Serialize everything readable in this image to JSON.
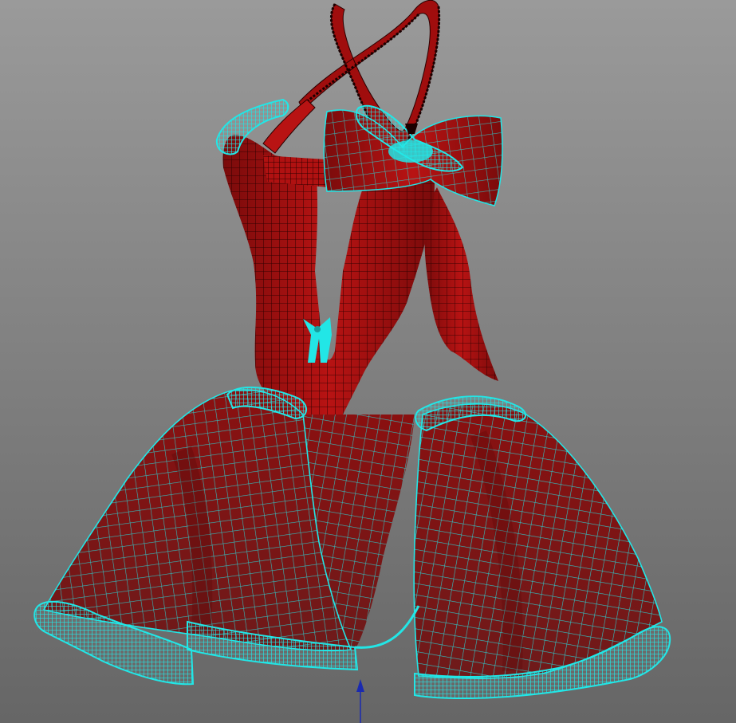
{
  "viewport": {
    "background_top": "#9a9a9a",
    "background_bottom": "#666666"
  },
  "model": {
    "object": "dress-mesh",
    "render_mode": "wireframe-on-shaded",
    "fill_color": "#8e0c0c",
    "fill_highlight": "#c01515",
    "wire_color_unselected": "#1a0000",
    "wire_color_selected": "#22e6e6",
    "parts": [
      {
        "id": "shoulder-straps",
        "selected": false
      },
      {
        "id": "bodice",
        "selected": false
      },
      {
        "id": "back-bow",
        "selected": false
      },
      {
        "id": "bow-ribbon-tail",
        "selected": false
      },
      {
        "id": "front-bow",
        "selected": true
      },
      {
        "id": "skirt-left",
        "selected": false
      },
      {
        "id": "skirt-right",
        "selected": false
      },
      {
        "id": "skirt-center-panel",
        "selected": false
      },
      {
        "id": "shoulder-ruffle",
        "selected": true
      },
      {
        "id": "waist-ruffle",
        "selected": true
      },
      {
        "id": "hem-trim",
        "selected": true
      }
    ]
  },
  "manipulator": {
    "axis": "y",
    "color": "#1a2ab0"
  }
}
